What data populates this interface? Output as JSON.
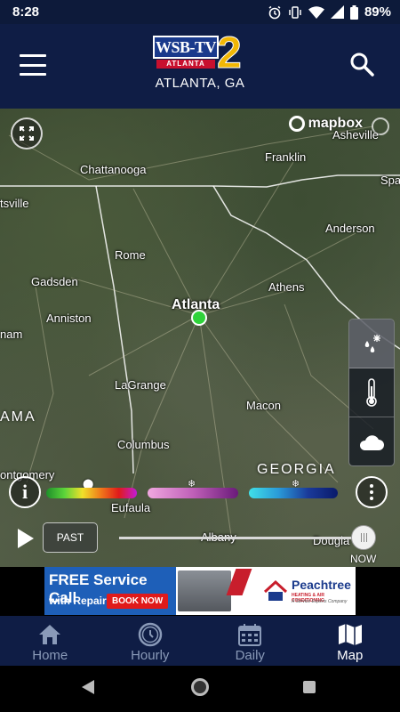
{
  "status_bar": {
    "time": "8:28",
    "battery": "89%"
  },
  "header": {
    "logo_main": "WSB-TV",
    "logo_sub": "ATLANTA",
    "logo_number": "2",
    "location": "ATLANTA, GA",
    "menu_icon": "hamburger-icon",
    "search_icon": "search-icon"
  },
  "map": {
    "attribution": "mapbox",
    "cities": [
      {
        "name": "Asheville"
      },
      {
        "name": "Chattanooga"
      },
      {
        "name": "Franklin"
      },
      {
        "name": "Spa"
      },
      {
        "name": "tsville"
      },
      {
        "name": "Anderson"
      },
      {
        "name": "Rome"
      },
      {
        "name": "Gadsden"
      },
      {
        "name": "Athens"
      },
      {
        "name": "Anniston"
      },
      {
        "name": "Atlanta"
      },
      {
        "name": "nam"
      },
      {
        "name": "LaGrange"
      },
      {
        "name": "Macon"
      },
      {
        "name": "AMA"
      },
      {
        "name": "Columbus"
      },
      {
        "name": "GEORGIA"
      },
      {
        "name": "ontgomery"
      },
      {
        "name": "Eufaula"
      },
      {
        "name": "Albany"
      },
      {
        "name": "Dougla"
      }
    ],
    "layers": [
      "precip-type-icon",
      "thermometer-icon",
      "cloud-icon"
    ],
    "info_label": "i",
    "past_label": "PAST",
    "now_label": "NOW",
    "timeline_position": 1.0
  },
  "ad": {
    "title": "FREE Service Call",
    "subtitle": "with Repair!",
    "cta": "BOOK NOW",
    "brand": "Peachtree",
    "brand_sub": "HEATING & AIR CONDITIONING",
    "brand_tag": "A Service Experts Company"
  },
  "bottom_nav": [
    {
      "label": "Home",
      "icon": "home-icon",
      "active": false
    },
    {
      "label": "Hourly",
      "icon": "clock-icon",
      "active": false
    },
    {
      "label": "Daily",
      "icon": "calendar-icon",
      "active": false
    },
    {
      "label": "Map",
      "icon": "map-icon",
      "active": true
    }
  ]
}
